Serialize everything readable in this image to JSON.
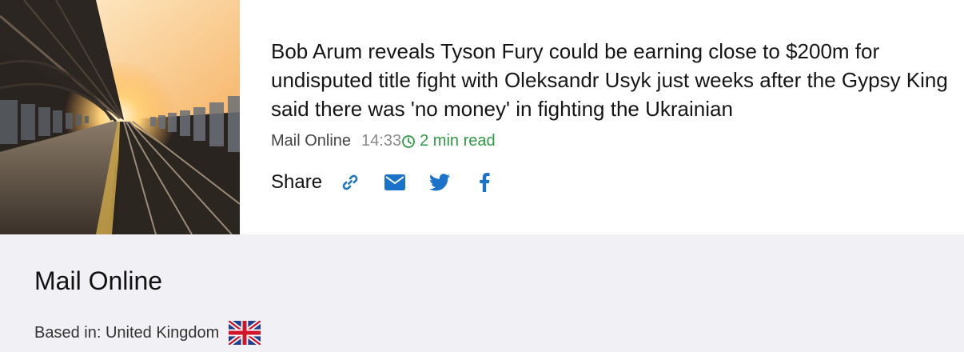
{
  "article": {
    "headline": "Bob Arum reveals Tyson Fury could be earning close to $200m for undisputed title fight with Oleksandr Usyk just weeks after the Gypsy King said there was 'no money' in fighting the Ukrainian",
    "source": "Mail Online",
    "time": "14:33",
    "read_time": "2 min read",
    "share_label": "Share",
    "share_icons": [
      "link-icon",
      "envelope-icon",
      "twitter-icon",
      "facebook-icon"
    ],
    "thumbnail": "train-platform-sunset-image"
  },
  "source_panel": {
    "name": "Mail Online",
    "based_in": "Based in: United Kingdom",
    "flag": "uk-flag-icon"
  },
  "colors": {
    "accent_blue": "#1a73c9",
    "read_time_green": "#2e9a44",
    "panel_background": "#f1f0f5"
  }
}
